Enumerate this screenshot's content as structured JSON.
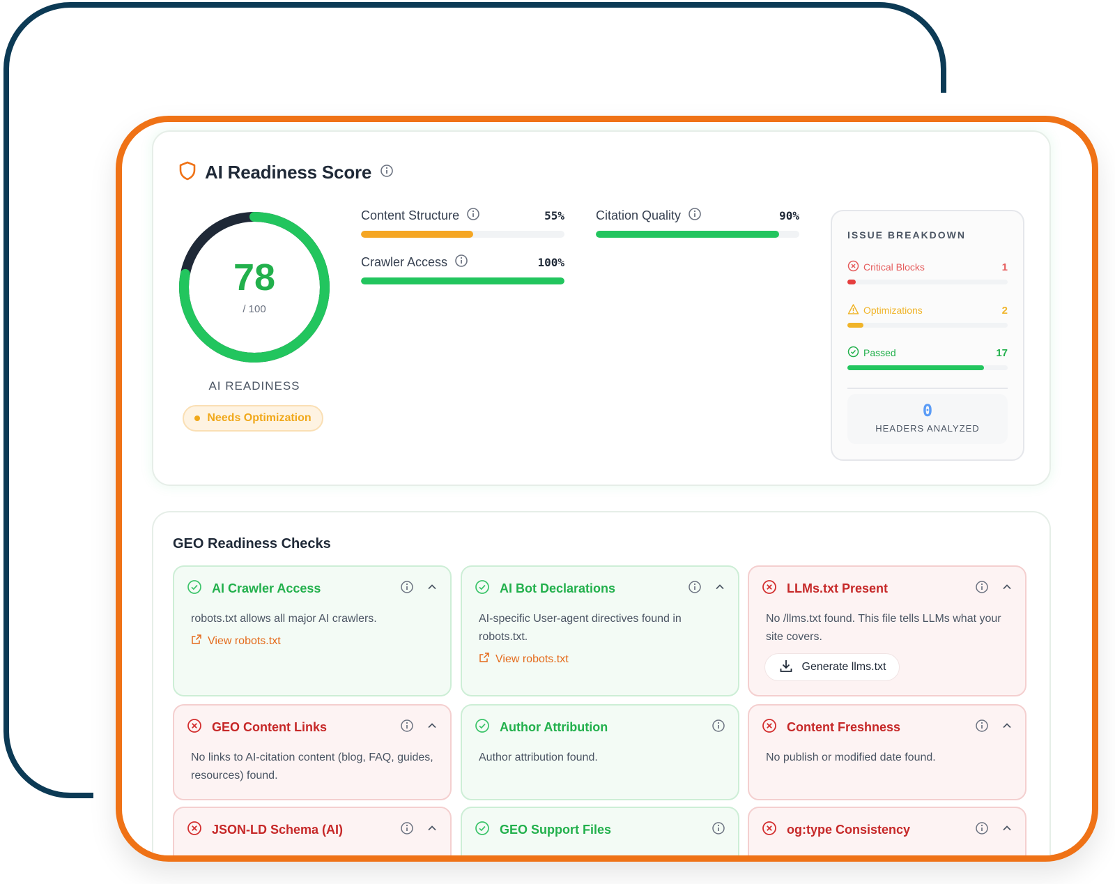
{
  "score_section": {
    "title": "AI Readiness Score",
    "score": "78",
    "score_max": "/ 100",
    "score_fraction": 0.78,
    "readiness_label": "AI READINESS",
    "status_badge": "Needs Optimization",
    "metrics": [
      {
        "name": "Content Structure",
        "percent": "55%",
        "fraction": 0.55,
        "color": "#f5a623"
      },
      {
        "name": "Citation Quality",
        "percent": "90%",
        "fraction": 0.9,
        "color": "#22c55e"
      },
      {
        "name": "Crawler Access",
        "percent": "100%",
        "fraction": 1.0,
        "color": "#22c55e"
      }
    ]
  },
  "issue_breakdown": {
    "title": "ISSUE BREAKDOWN",
    "items": [
      {
        "label": "Critical Blocks",
        "count": "1",
        "fraction": 0.05,
        "color": "#e53e3e",
        "icon": "x-circle-icon"
      },
      {
        "label": "Optimizations",
        "count": "2",
        "fraction": 0.1,
        "color": "#f0b429",
        "icon": "warning-triangle-icon"
      },
      {
        "label": "Passed",
        "count": "17",
        "fraction": 0.85,
        "color": "#22c55e",
        "icon": "check-circle-icon"
      }
    ],
    "headers_count": "0",
    "headers_label": "HEADERS ANALYZED"
  },
  "checks": {
    "title": "GEO Readiness Checks",
    "cards": [
      {
        "title": "AI Crawler Access",
        "status": "pass",
        "desc": "robots.txt allows all major AI crawlers.",
        "link": "View robots.txt"
      },
      {
        "title": "AI Bot Declarations",
        "status": "pass",
        "desc": "AI-specific User-agent directives found in robots.txt.",
        "link": "View robots.txt"
      },
      {
        "title": "LLMs.txt Present",
        "status": "fail",
        "desc": "No /llms.txt found. This file tells LLMs what your site covers.",
        "button": "Generate llms.txt"
      },
      {
        "title": "GEO Content Links",
        "status": "fail",
        "desc": "No links to AI-citation content (blog, FAQ, guides, resources) found."
      },
      {
        "title": "Author Attribution",
        "status": "pass",
        "desc": "Author attribution found."
      },
      {
        "title": "Content Freshness",
        "status": "fail",
        "desc": "No publish or modified date found."
      },
      {
        "title": "JSON-LD Schema (AI)",
        "status": "fail",
        "desc": ""
      },
      {
        "title": "GEO Support Files",
        "status": "pass",
        "desc": ""
      },
      {
        "title": "og:type Consistency",
        "status": "fail",
        "desc": ""
      }
    ]
  },
  "colors": {
    "brand_orange": "#ef7216",
    "frame_navy": "#0c3a55",
    "pass_green": "#22b04c",
    "fail_red": "#c62828",
    "ring_dark": "#1f2937"
  }
}
